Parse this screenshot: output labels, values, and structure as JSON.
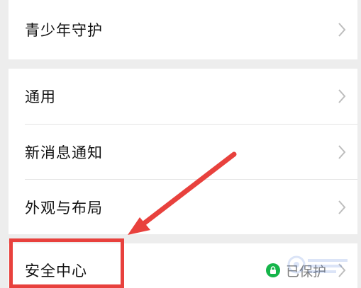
{
  "settings": {
    "items": [
      {
        "label": "青少年守护"
      },
      {
        "label": "通用"
      },
      {
        "label": "新消息通知"
      },
      {
        "label": "外观与布局"
      },
      {
        "label": "安全中心",
        "status": "已保护"
      }
    ]
  },
  "colors": {
    "background": "#ededed",
    "card": "#ffffff",
    "accent_green": "#15b54a",
    "annotation_red": "#e8413d"
  },
  "icons": {
    "chevron": "chevron-right-icon",
    "lock": "lock-icon"
  }
}
